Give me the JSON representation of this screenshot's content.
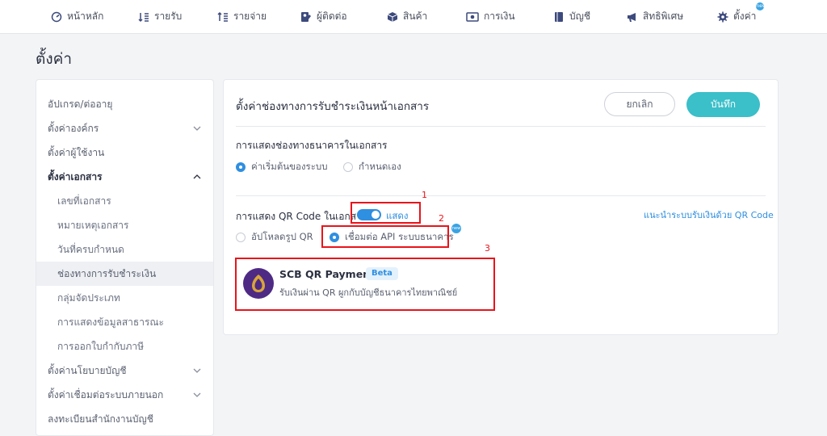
{
  "nav": {
    "items": [
      {
        "label": "หน้าหลัก",
        "icon": "dashboard-icon"
      },
      {
        "label": "รายรับ",
        "icon": "income-icon"
      },
      {
        "label": "รายจ่าย",
        "icon": "expense-icon"
      },
      {
        "label": "ผู้ติดต่อ",
        "icon": "contacts-icon"
      },
      {
        "label": "สินค้า",
        "icon": "product-box-icon"
      },
      {
        "label": "การเงิน",
        "icon": "money-icon"
      },
      {
        "label": "บัญชี",
        "icon": "ledger-book-icon"
      },
      {
        "label": "สิทธิพิเศษ",
        "icon": "megaphone-icon"
      },
      {
        "label": "ตั้งค่า",
        "icon": "gear-icon",
        "badge": "new"
      }
    ]
  },
  "page": {
    "title": "ตั้งค่า"
  },
  "sidebar": {
    "items": [
      {
        "label": "อัปเกรด/ต่ออายุ"
      },
      {
        "label": "ตั้งค่าองค์กร",
        "chevron": "down"
      },
      {
        "label": "ตั้งค่าผู้ใช้งาน"
      },
      {
        "label": "ตั้งค่าเอกสาร",
        "chevron": "up"
      },
      {
        "label": "เลขที่เอกสาร"
      },
      {
        "label": "หมายเหตุเอกสาร"
      },
      {
        "label": "วันที่ครบกำหนด"
      },
      {
        "label": "ช่องทางการรับชำระเงิน"
      },
      {
        "label": "กลุ่มจัดประเภท"
      },
      {
        "label": "การแสดงข้อมูลสาธารณะ"
      },
      {
        "label": "การออกใบกำกับภาษี"
      },
      {
        "label": "ตั้งค่านโยบายบัญชี",
        "chevron": "down"
      },
      {
        "label": "ตั้งค่าเชื่อมต่อระบบภายนอก",
        "chevron": "down"
      },
      {
        "label": "ลงทะเบียนสำนักงานบัญชี"
      }
    ]
  },
  "panel": {
    "title": "ตั้งค่าช่องทางการรับชำระเงินหน้าเอกสาร",
    "cancel_label": "ยกเลิก",
    "save_label": "บันทึก",
    "bank_section": {
      "label": "การแสดงช่องทางธนาคารในเอกสาร",
      "options": [
        {
          "label": "ค่าเริ่มต้นของระบบ",
          "selected": true
        },
        {
          "label": "กำหนดเอง",
          "selected": false
        }
      ]
    },
    "qr_section": {
      "label": "การแสดง QR Code ในเอกสาร",
      "toggle_on": true,
      "toggle_label": "แสดง",
      "help_link": "แนะนำระบบรับเงินด้วย QR Code",
      "options": [
        {
          "label": "อัปโหลดรูป QR",
          "selected": false
        },
        {
          "label": "เชื่อมต่อ API ระบบธนาคาร",
          "selected": true,
          "badge": "new"
        }
      ]
    },
    "provider": {
      "name": "SCB QR Payment",
      "badge": "Beta",
      "description": "รับเงินผ่าน QR ผูกกับบัญชีธนาคารไทยพาณิชย์"
    }
  },
  "annotations": [
    "1",
    "2",
    "3"
  ],
  "colors": {
    "accent": "#2f8fe0",
    "save": "#3bbfc9",
    "highlight": "#e8141b",
    "scb": "#4e2a84"
  }
}
